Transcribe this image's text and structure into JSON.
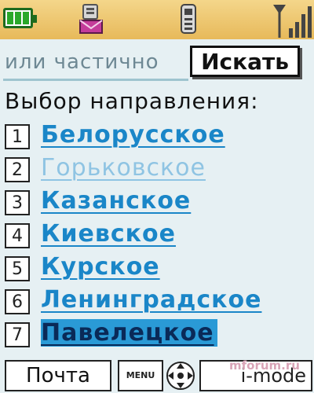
{
  "status": {
    "battery_icon": "battery-full-icon",
    "mail_icon": "mail-icon",
    "phone_icon": "phone-icon",
    "signal_icon": "signal-strength-icon",
    "battery_level": 1.0
  },
  "search": {
    "hint": "или частично",
    "button_label": "Искать"
  },
  "section_title": "Выбор направления:",
  "items": [
    {
      "num": "1",
      "label": "Белорусское",
      "state": "normal"
    },
    {
      "num": "2",
      "label": "Горьковское",
      "state": "visited"
    },
    {
      "num": "3",
      "label": "Казанское",
      "state": "normal"
    },
    {
      "num": "4",
      "label": "Киевское",
      "state": "normal"
    },
    {
      "num": "5",
      "label": "Курское",
      "state": "normal"
    },
    {
      "num": "6",
      "label": "Ленинградское",
      "state": "normal"
    },
    {
      "num": "7",
      "label": "Павелецкое",
      "state": "selected"
    }
  ],
  "softkeys": {
    "left": "Почта",
    "menu": "MENU",
    "right": "i-mode"
  },
  "watermark": "mforum.ru",
  "colors": {
    "link": "#1a86c8",
    "visited": "#8fc4e3",
    "selected_bg": "#2a9ad6",
    "status_bar": "#e7b95a"
  }
}
